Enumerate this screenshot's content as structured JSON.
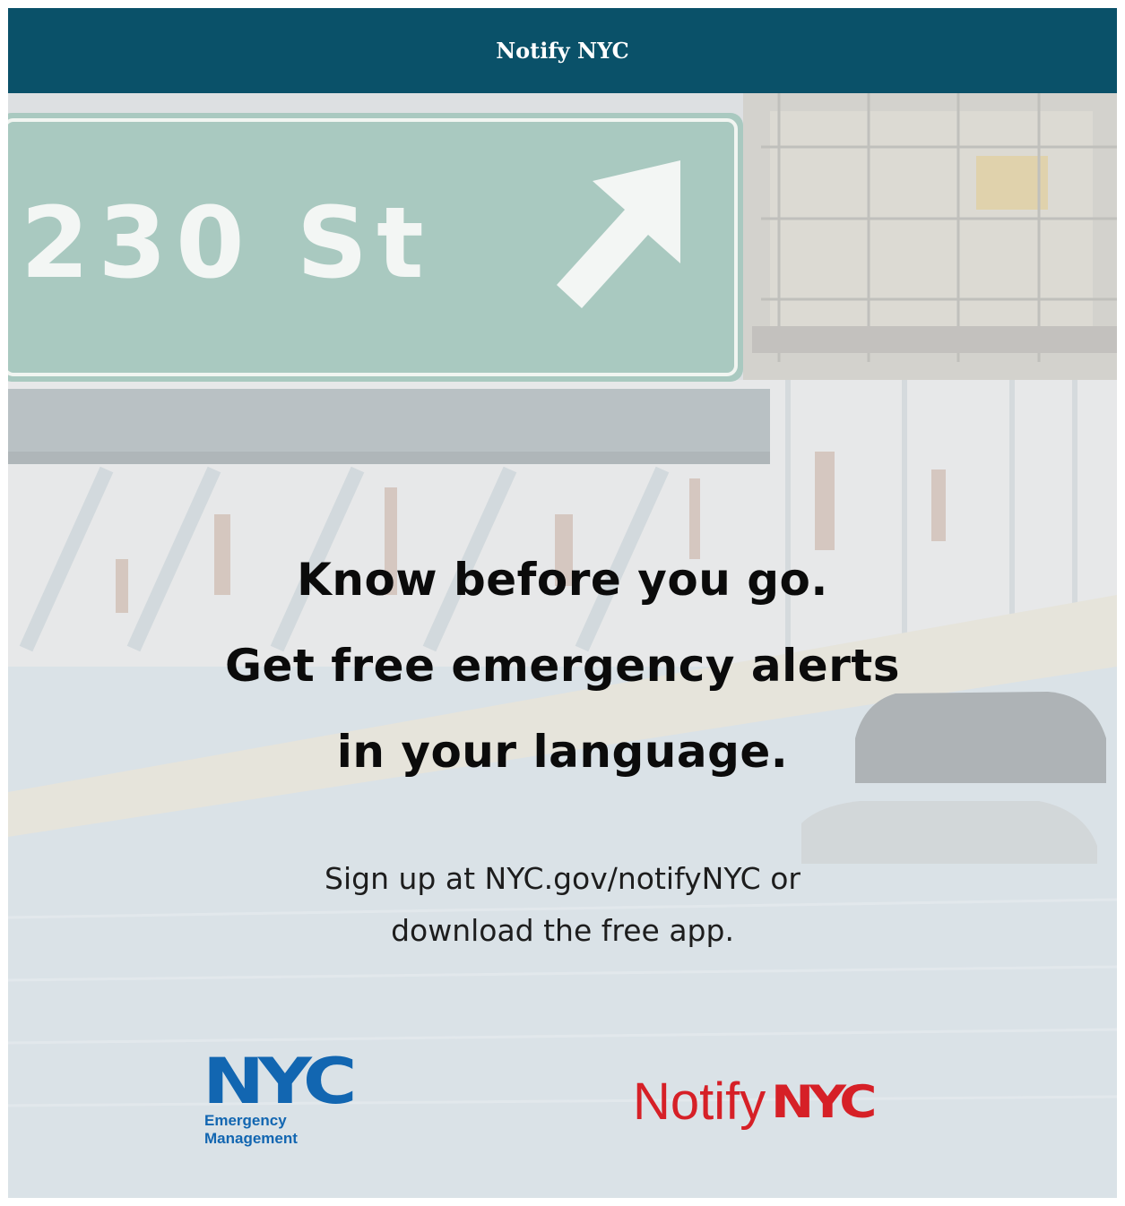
{
  "header": {
    "title": "Notify NYC"
  },
  "hero": {
    "sign_text": "230 St",
    "headline_lines": [
      "Know before you go.",
      "Get free emergency alerts",
      "in your language."
    ],
    "signup_lines": [
      "Sign up at NYC.gov/notifyNYC or",
      "download the free app."
    ]
  },
  "logos": {
    "nycem": {
      "wordmark": "NYC",
      "line1": "Emergency",
      "line2": "Management"
    },
    "notify": {
      "word": "Notify",
      "wordmark": "NYC"
    }
  },
  "colors": {
    "header_bg": "#0a5169",
    "nyc_blue": "#1266b1",
    "notify_red": "#d62027"
  }
}
